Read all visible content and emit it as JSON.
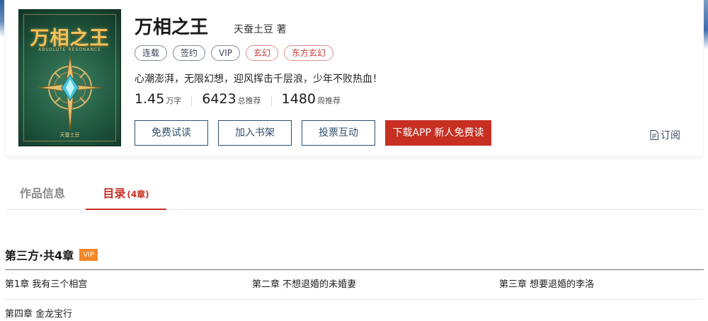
{
  "book": {
    "cover_title": "万相之王",
    "cover_subtitle": "ABSOLUTE RESONANCE",
    "cover_author": "天蚕土豆",
    "title": "万相之王",
    "author": "天蚕土豆 著",
    "tags": [
      "连载",
      "签约",
      "VIP",
      "玄幻",
      "东方玄幻"
    ],
    "intro": "心潮澎湃，无限幻想，迎风挥击千层浪，少年不败热血！",
    "stats": [
      {
        "value": "1.45",
        "unit": "万字"
      },
      {
        "value": "6423",
        "unit": "总推荐"
      },
      {
        "value": "1480",
        "unit": "周推荐"
      }
    ]
  },
  "actions": {
    "free_read": "免费试读",
    "add_shelf": "加入书架",
    "vote": "投票互动",
    "download_app": "下载APP 新人免费读",
    "subscribe": "订阅"
  },
  "tabs": {
    "info": "作品信息",
    "toc": "目录",
    "toc_count": "(4章)"
  },
  "volume": {
    "title": "第三方·共4章",
    "badge": "VIP",
    "chapters": [
      "第1章 我有三个相宫",
      "第二章 不想退婚的未婚妻",
      "第三章 想要退婚的李洛",
      "第四章 金龙宝行"
    ]
  },
  "colors": {
    "accent_red": "#c62f22",
    "button_border": "#2f4f6e",
    "vip_orange": "#f4872a"
  }
}
